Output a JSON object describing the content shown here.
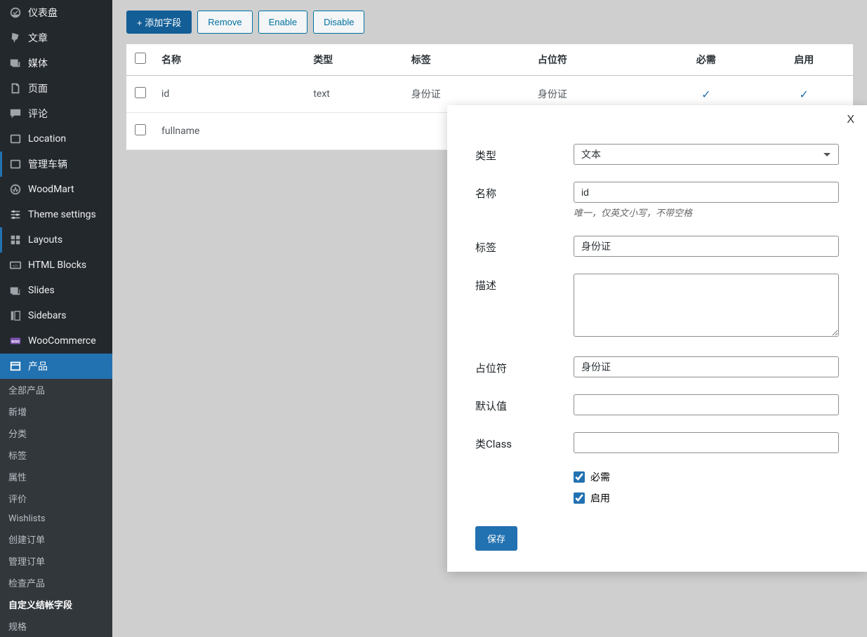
{
  "sidebar": {
    "items": [
      {
        "label": "仪表盘",
        "icon": "dashboard"
      },
      {
        "label": "文章",
        "icon": "pin"
      },
      {
        "label": "媒体",
        "icon": "media"
      },
      {
        "label": "页面",
        "icon": "page"
      },
      {
        "label": "评论",
        "icon": "comment"
      },
      {
        "label": "Location",
        "icon": "location"
      },
      {
        "label": "管理车辆",
        "icon": "car"
      },
      {
        "label": "WoodMart",
        "icon": "woodmart"
      },
      {
        "label": "Theme settings",
        "icon": "settings"
      },
      {
        "label": "Layouts",
        "icon": "layouts"
      },
      {
        "label": "HTML Blocks",
        "icon": "html"
      },
      {
        "label": "Slides",
        "icon": "slides"
      },
      {
        "label": "Sidebars",
        "icon": "sidebars"
      },
      {
        "label": "WooCommerce",
        "icon": "woo"
      },
      {
        "label": "产品",
        "icon": "product"
      }
    ],
    "sub": [
      {
        "label": "全部产品"
      },
      {
        "label": "新增"
      },
      {
        "label": "分类"
      },
      {
        "label": "标签"
      },
      {
        "label": "属性"
      },
      {
        "label": "评价"
      },
      {
        "label": "Wishlists"
      },
      {
        "label": "创建订单"
      },
      {
        "label": "管理订单"
      },
      {
        "label": "检查产品"
      },
      {
        "label": "自定义结帐字段",
        "current": true
      },
      {
        "label": "规格"
      }
    ]
  },
  "toolbar": {
    "add": "+ 添加字段",
    "remove": "Remove",
    "enable": "Enable",
    "disable": "Disable"
  },
  "table": {
    "headers": {
      "name": "名称",
      "type": "类型",
      "label": "标签",
      "placeholder": "占位符",
      "required": "必需",
      "enabled": "启用"
    },
    "rows": [
      {
        "name": "id",
        "type": "text",
        "label": "身份证",
        "placeholder": "身份证",
        "required": true,
        "enabled": true
      },
      {
        "name": "fullname",
        "type": "",
        "label": "",
        "placeholder": "",
        "required": false,
        "enabled": false
      }
    ]
  },
  "modal": {
    "close": "X",
    "labels": {
      "type": "类型",
      "name": "名称",
      "label": "标签",
      "description": "描述",
      "placeholder": "占位符",
      "default": "默认值",
      "class": "类Class",
      "required": "必需",
      "enabled": "启用"
    },
    "values": {
      "type": "文本",
      "name": "id",
      "name_hint": "唯一，仅英文小写，不带空格",
      "label": "身份证",
      "description": "",
      "placeholder": "身份证",
      "default": "",
      "class": "",
      "required": true,
      "enabled": true
    },
    "save": "保存"
  }
}
